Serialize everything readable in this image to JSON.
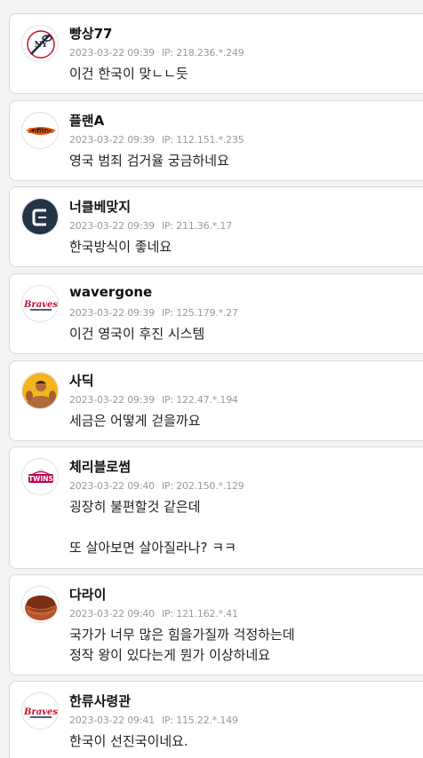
{
  "comments": [
    {
      "nickname": "빵상77",
      "date": "2023-03-22 09:39",
      "ip_label": "IP:",
      "ip": "218.236.*.249",
      "text": "이건 한국이 맞ㄴㄴ듯",
      "avatar": "yankees-logo-icon"
    },
    {
      "nickname": "플랜A",
      "date": "2023-03-22 09:39",
      "ip_label": "IP:",
      "ip": "112.151.*.235",
      "text": "영국 범죄 검거율 궁금하네요",
      "avatar": "eagles-logo-icon"
    },
    {
      "nickname": "너클베맞지",
      "date": "2023-03-22 09:39",
      "ip_label": "IP:",
      "ip": "211.36.*.17",
      "text": "한국방식이 좋네요",
      "avatar": "c-logo-icon"
    },
    {
      "nickname": "wavergone",
      "date": "2023-03-22 09:39",
      "ip_label": "IP:",
      "ip": "125.179.*.27",
      "text": "이건 영국이 후진 시스템",
      "avatar": "braves-logo-icon"
    },
    {
      "nickname": "사딕",
      "date": "2023-03-22 09:39",
      "ip_label": "IP:",
      "ip": "122.47.*.194",
      "text": "세금은 어떻게 걷을까요",
      "avatar": "bodybuilder-photo-icon"
    },
    {
      "nickname": "체리블로썸",
      "date": "2023-03-22 09:40",
      "ip_label": "IP:",
      "ip": "202.150.*.129",
      "text": "굉장히 불편할것 같은데\n\n또 살아보면 살아질라나? ㅋㅋ",
      "avatar": "twins-logo-icon"
    },
    {
      "nickname": "다라이",
      "date": "2023-03-22 09:40",
      "ip_label": "IP:",
      "ip": "121.162.*.41",
      "text": "국가가 너무 많은 힘을가질까 걱정하는데\n정작 왕이 있다는게 뭔가 이상하네요",
      "avatar": "basin-photo-icon"
    },
    {
      "nickname": "한류사령관",
      "date": "2023-03-22 09:41",
      "ip_label": "IP:",
      "ip": "115.22.*.149",
      "text": "한국이 선진국이네요.",
      "avatar": "braves-logo-icon"
    }
  ]
}
